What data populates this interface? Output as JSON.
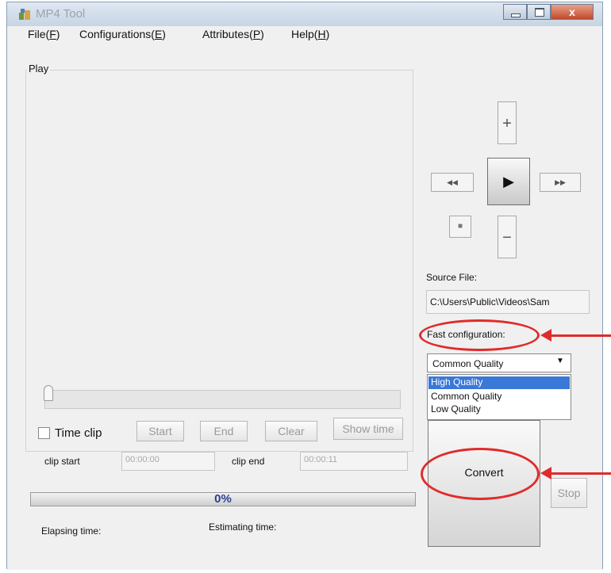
{
  "window": {
    "title": "MP4 Tool"
  },
  "menu": [
    {
      "label": "File(",
      "key": "F",
      "tail": ")"
    },
    {
      "label": "Configurations(",
      "key": "E",
      "tail": ")"
    },
    {
      "label": "Attributes(",
      "key": "P",
      "tail": ")"
    },
    {
      "label": "Help(",
      "key": "H",
      "tail": ")"
    }
  ],
  "play": {
    "group_label": "Play",
    "time_clip_label": "Time clip",
    "start_label": "Start",
    "end_label": "End",
    "clear_label": "Clear",
    "show_time_label": "Show time",
    "clip_start_label": "clip start",
    "clip_start_value": "00:00:00",
    "clip_end_label": "clip end",
    "clip_end_value": "00:00:11",
    "progress_text": "0%",
    "progress_value": 0,
    "elapsing_label": "Elapsing time:",
    "estimating_label": "Estimating time:"
  },
  "controls": {
    "plus": "+",
    "minus": "−",
    "rewind": "◀◀",
    "play": "▶",
    "forward": "▶▶",
    "stop": "■"
  },
  "source": {
    "label": "Source File:",
    "value": "C:\\Users\\Public\\Videos\\Sam"
  },
  "fast_config": {
    "label": "Fast configuration:",
    "selected": "Common Quality",
    "options": [
      "High Quality",
      "Common Quality",
      "Low Quality"
    ],
    "highlighted_index": 0
  },
  "actions": {
    "convert_label": "Convert",
    "stop_label": "Stop"
  },
  "colors": {
    "annotation": "#e02b2b",
    "highlight": "#3a78d8",
    "progress_text": "#2a3f8f"
  }
}
